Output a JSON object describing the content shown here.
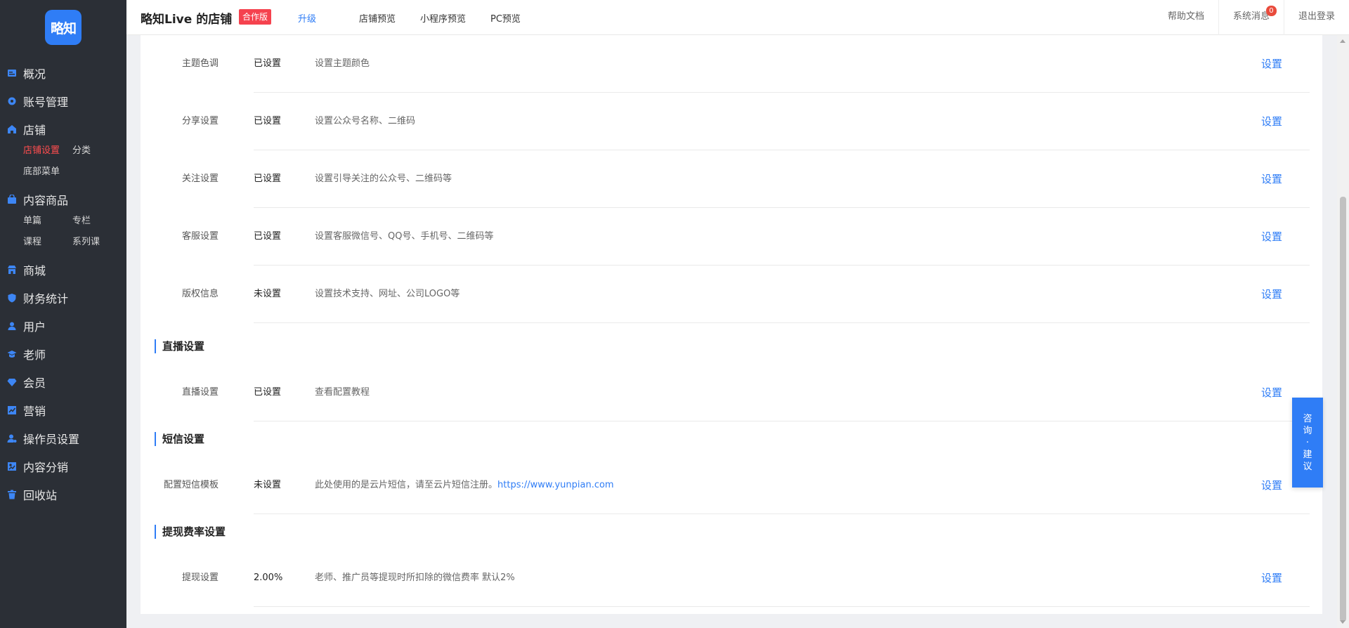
{
  "app": {
    "logo_text": "略知"
  },
  "sidebar": {
    "items": [
      {
        "label": "概况",
        "icon": "overview-icon"
      },
      {
        "label": "账号管理",
        "icon": "gear-icon"
      },
      {
        "label": "店铺",
        "icon": "home-icon",
        "children": [
          {
            "label": "店铺设置",
            "active": true
          },
          {
            "label": "分类"
          },
          {
            "label": "底部菜单"
          }
        ]
      },
      {
        "label": "内容商品",
        "icon": "bag-icon",
        "children": [
          {
            "label": "单篇"
          },
          {
            "label": "专栏"
          },
          {
            "label": "课程"
          },
          {
            "label": "系列课"
          }
        ]
      },
      {
        "label": "商城",
        "icon": "store-icon"
      },
      {
        "label": "财务统计",
        "icon": "shield-icon"
      },
      {
        "label": "用户",
        "icon": "user-icon"
      },
      {
        "label": "老师",
        "icon": "graduation-cap-icon"
      },
      {
        "label": "会员",
        "icon": "diamond-icon"
      },
      {
        "label": "营销",
        "icon": "chart-icon"
      },
      {
        "label": "操作员设置",
        "icon": "user-gear-icon"
      },
      {
        "label": "内容分销",
        "icon": "share-icon"
      },
      {
        "label": "回收站",
        "icon": "trash-icon"
      }
    ]
  },
  "header": {
    "shop_title": "略知Live 的店铺",
    "edition_badge": "合作版",
    "upgrade": "升级",
    "links": [
      "店铺预览",
      "小程序预览",
      "PC预览"
    ],
    "help": "帮助文档",
    "messages": "系统消息",
    "message_count": "0",
    "logout": "退出登录"
  },
  "settings": {
    "action_label": "设置",
    "rows_top": [
      {
        "label": "主题色调",
        "status": "已设置",
        "desc": "设置主题颜色"
      },
      {
        "label": "分享设置",
        "status": "已设置",
        "desc": "设置公众号名称、二维码"
      },
      {
        "label": "关注设置",
        "status": "已设置",
        "desc": "设置引导关注的公众号、二维码等"
      },
      {
        "label": "客服设置",
        "status": "已设置",
        "desc": "设置客服微信号、QQ号、手机号、二维码等"
      },
      {
        "label": "版权信息",
        "status": "未设置",
        "desc": "设置技术支持、网址、公司LOGO等"
      }
    ],
    "live": {
      "title": "直播设置",
      "row": {
        "label": "直播设置",
        "status": "已设置",
        "desc": "查看配置教程"
      }
    },
    "sms": {
      "title": "短信设置",
      "row": {
        "label": "配置短信模板",
        "status": "未设置",
        "desc": "此处使用的是云片短信，请至云片短信注册。",
        "link": "https://www.yunpian.com"
      }
    },
    "withdraw": {
      "title": "提现费率设置",
      "row": {
        "label": "提现设置",
        "status": "2.00%",
        "desc": "老师、推广员等提现时所扣除的微信费率 默认2%"
      }
    }
  },
  "consult": {
    "chars": [
      "咨",
      "询",
      "·",
      "建",
      "议"
    ]
  },
  "colors": {
    "accent": "#2f7df6",
    "sidebar_bg": "#2b2f36",
    "active_red": "#ff4d4f",
    "badge_red": "#f5424e"
  }
}
